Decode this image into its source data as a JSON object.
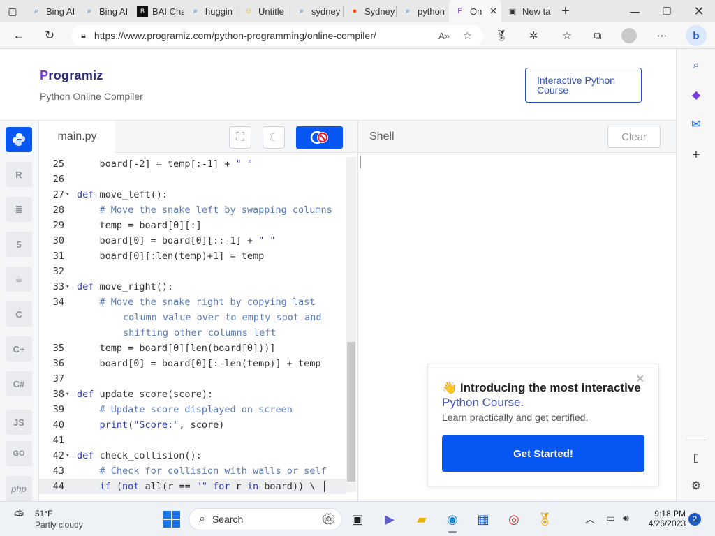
{
  "browser": {
    "tabs": [
      {
        "label": "Bing AI",
        "icon": "search-icon"
      },
      {
        "label": "Bing AI",
        "icon": "search-icon"
      },
      {
        "label": "BAI Cha",
        "icon": "bai-icon"
      },
      {
        "label": "huggin",
        "icon": "search-icon"
      },
      {
        "label": "Untitle",
        "icon": "emoji-icon"
      },
      {
        "label": "sydney",
        "icon": "search-icon"
      },
      {
        "label": "Sydney",
        "icon": "reddit-icon"
      },
      {
        "label": "python",
        "icon": "search-icon"
      },
      {
        "label": "On",
        "icon": "programiz-icon",
        "active": true
      },
      {
        "label": "New ta",
        "icon": "newtab-icon"
      }
    ],
    "url": "https://www.programiz.com/python-programming/online-compiler/"
  },
  "header": {
    "logo_prefix": "P",
    "logo_rest": "rogramiz",
    "subtitle": "Python Online Compiler",
    "course_button": "Interactive Python Course"
  },
  "editor": {
    "filename": "main.py",
    "lines": [
      {
        "n": "25",
        "fold": false,
        "current": false,
        "code": "    board[-2] = temp[:-1] + \" \"",
        "cont": []
      },
      {
        "n": "26",
        "fold": false,
        "current": false,
        "code": "",
        "cont": []
      },
      {
        "n": "27",
        "fold": true,
        "current": false,
        "code": "def move_left():",
        "cont": []
      },
      {
        "n": "28",
        "fold": false,
        "current": false,
        "code": "    # Move the snake left by swapping columns",
        "cont": []
      },
      {
        "n": "29",
        "fold": false,
        "current": false,
        "code": "    temp = board[0][:]",
        "cont": []
      },
      {
        "n": "30",
        "fold": false,
        "current": false,
        "code": "    board[0] = board[0][::-1] + \" \"",
        "cont": []
      },
      {
        "n": "31",
        "fold": false,
        "current": false,
        "code": "    board[0][:len(temp)+1] = temp",
        "cont": []
      },
      {
        "n": "32",
        "fold": false,
        "current": false,
        "code": "",
        "cont": []
      },
      {
        "n": "33",
        "fold": true,
        "current": false,
        "code": "def move_right():",
        "cont": []
      },
      {
        "n": "34",
        "fold": false,
        "current": false,
        "code": "    # Move the snake right by copying last",
        "cont": [
          "column value over to empty spot and",
          "shifting other columns left"
        ]
      },
      {
        "n": "35",
        "fold": false,
        "current": false,
        "code": "    temp = board[0][len(board[0]))]",
        "cont": []
      },
      {
        "n": "36",
        "fold": false,
        "current": false,
        "code": "    board[0] = board[0][:-len(temp)] + temp",
        "cont": []
      },
      {
        "n": "37",
        "fold": false,
        "current": false,
        "code": "",
        "cont": []
      },
      {
        "n": "38",
        "fold": true,
        "current": false,
        "code": "def update_score(score):",
        "cont": []
      },
      {
        "n": "39",
        "fold": false,
        "current": false,
        "code": "    # Update score displayed on screen",
        "cont": []
      },
      {
        "n": "40",
        "fold": false,
        "current": false,
        "code": "    print(\"Score:\", score)",
        "cont": []
      },
      {
        "n": "41",
        "fold": false,
        "current": false,
        "code": "",
        "cont": []
      },
      {
        "n": "42",
        "fold": true,
        "current": false,
        "code": "def check_collision():",
        "cont": []
      },
      {
        "n": "43",
        "fold": false,
        "current": false,
        "code": "    # Check for collision with walls or self",
        "cont": []
      },
      {
        "n": "44",
        "fold": false,
        "current": true,
        "code": "    if (not all(r == \"\" for r in board)) \\",
        "cont": []
      }
    ]
  },
  "shell": {
    "title": "Shell",
    "clear_label": "Clear"
  },
  "promo": {
    "emoji": "👋",
    "title_part1": "Introducing the most interactive",
    "title_highlight": "Python Course.",
    "subtitle": "Learn practically and get certified.",
    "button": "Get Started!"
  },
  "languages": [
    "python",
    "R",
    "sql",
    "html5",
    "java",
    "C",
    "C++",
    "C#",
    "JS",
    "GO",
    "php"
  ],
  "taskbar": {
    "weather_temp": "51°F",
    "weather_cond": "Partly cloudy",
    "search_label": "Search",
    "time": "9:18 PM",
    "date": "4/26/2023",
    "notifications": "2"
  },
  "colors": {
    "accent": "#0556f3",
    "logo": "#2c2a7a",
    "keyword": "#2d39a8",
    "comment": "#5a7ab8"
  }
}
